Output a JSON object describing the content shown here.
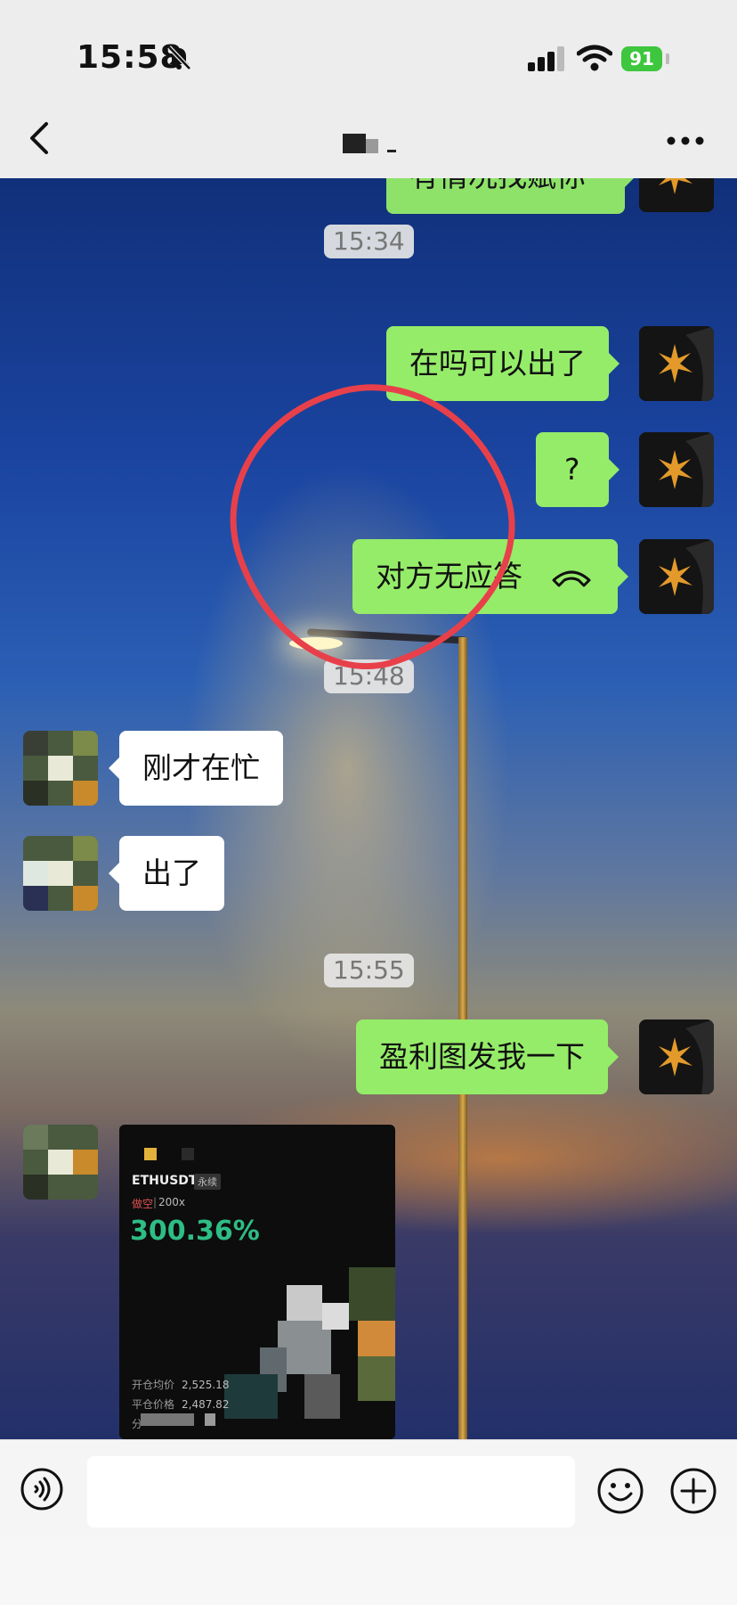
{
  "status_bar": {
    "time": "15:58",
    "battery": "91"
  },
  "nav": {
    "title": ""
  },
  "messages": [
    {
      "kind": "outgoing",
      "text": "有情况找赋你",
      "partial": true
    },
    {
      "kind": "timestamp",
      "text": "15:34"
    },
    {
      "kind": "outgoing",
      "text": "在吗可以出了"
    },
    {
      "kind": "outgoing",
      "text": "?"
    },
    {
      "kind": "outgoing",
      "text": "对方无应答"
    },
    {
      "kind": "timestamp",
      "text": "15:48"
    },
    {
      "kind": "incoming",
      "text": "刚才在忙"
    },
    {
      "kind": "incoming",
      "text": "出了"
    },
    {
      "kind": "timestamp",
      "text": "15:55"
    },
    {
      "kind": "outgoing",
      "text": "盈利图发我一下"
    },
    {
      "kind": "incoming-image"
    }
  ],
  "trade_card": {
    "symbol": "ETHUSDT",
    "tag": "永续",
    "side": "做空",
    "leverage": "200x",
    "pnl_pct": "300.36%",
    "open_label": "开仓均价",
    "open_price": "2,525.18",
    "close_label": "平仓价格",
    "close_price": "2,487.82",
    "share_label": "分"
  },
  "annotation_color": "#e8404a",
  "icons": [
    "back-arrow-icon",
    "more-icon",
    "voice-icon",
    "emoji-icon",
    "plus-icon",
    "muted-bell-icon",
    "signal-icon",
    "wifi-icon",
    "hangup-icon"
  ]
}
